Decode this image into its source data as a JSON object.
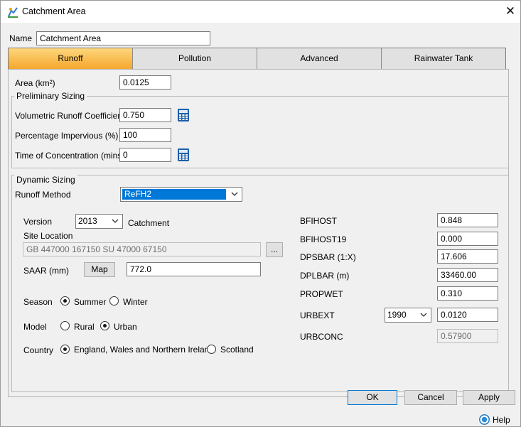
{
  "window": {
    "title": "Catchment Area",
    "close_glyph": "✕"
  },
  "name_field": {
    "label": "Name",
    "value": "Catchment Area"
  },
  "tabs": [
    {
      "label": "Runoff",
      "active": true
    },
    {
      "label": "Pollution",
      "active": false
    },
    {
      "label": "Advanced",
      "active": false
    },
    {
      "label": "Rainwater Tank",
      "active": false
    }
  ],
  "area": {
    "label": "Area (km²)",
    "value": "0.0125"
  },
  "preliminary": {
    "title": "Preliminary Sizing",
    "runoff_coeff": {
      "label": "Volumetric Runoff Coefficient",
      "value": "0.750"
    },
    "impervious": {
      "label": "Percentage Impervious (%)",
      "value": "100"
    },
    "toc": {
      "label": "Time of Concentration (mins)",
      "value": "0"
    }
  },
  "dynamic": {
    "title": "Dynamic Sizing",
    "method_label": "Runoff Method",
    "method_value": "ReFH2",
    "version_label": "Version",
    "version_value": "2013",
    "catchment_label": "Catchment",
    "site_label": "Site Location",
    "site_value": "GB 447000 167150 SU 47000 67150",
    "browse_label": "...",
    "saar_label": "SAAR (mm)",
    "map_label": "Map",
    "saar_value": "772.0",
    "season_label": "Season",
    "season_options": [
      {
        "label": "Summer",
        "selected": true
      },
      {
        "label": "Winter",
        "selected": false
      }
    ],
    "model_label": "Model",
    "model_options": [
      {
        "label": "Rural",
        "selected": false
      },
      {
        "label": "Urban",
        "selected": true
      }
    ],
    "country_label": "Country",
    "country_options": [
      {
        "label": "England, Wales and Northern Ireland",
        "selected": true
      },
      {
        "label": "Scotland",
        "selected": false
      }
    ],
    "params": {
      "bfihost": {
        "label": "BFIHOST",
        "value": "0.848"
      },
      "bfihost19": {
        "label": "BFIHOST19",
        "value": "0.000"
      },
      "dpsbar": {
        "label": "DPSBAR (1:X)",
        "value": "17.606"
      },
      "dplbar": {
        "label": "DPLBAR (m)",
        "value": "33460.00"
      },
      "propwet": {
        "label": "PROPWET",
        "value": "0.310"
      },
      "urbext": {
        "label": "URBEXT",
        "year": "1990",
        "value": "0.0120"
      },
      "urbconc": {
        "label": "URBCONC",
        "value": "0.57900"
      }
    }
  },
  "buttons": {
    "ok": "OK",
    "cancel": "Cancel",
    "apply": "Apply",
    "help": "Help"
  },
  "colors": {
    "tab_active_top": "#fdd77c",
    "tab_active_bottom": "#f6a72e",
    "selection": "#0078d7",
    "calc_blue": "#1f5fa8"
  }
}
